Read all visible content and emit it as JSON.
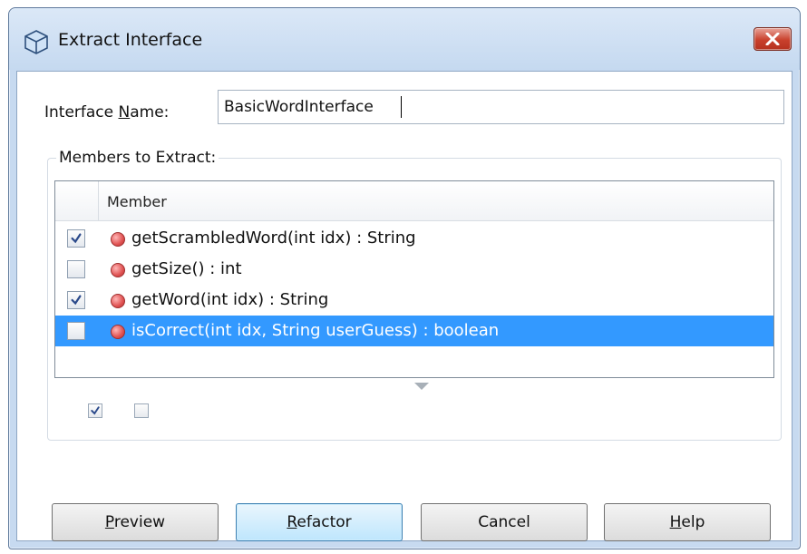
{
  "window": {
    "title": "Extract Interface",
    "close_icon": "close-x-icon",
    "app_icon": "interface-cube-icon"
  },
  "interface_name": {
    "label_before": "Interface ",
    "label_mnemonic": "N",
    "label_after": "ame:",
    "value": "BasicWordInterface"
  },
  "members": {
    "group_label": "Members to Extract:",
    "column_header": "Member",
    "rows": [
      {
        "label": "getScrambledWord(int idx) : String",
        "checked": true,
        "selected": false
      },
      {
        "label": "getSize() : int",
        "checked": false,
        "selected": false
      },
      {
        "label": "getWord(int idx) : String",
        "checked": true,
        "selected": false
      },
      {
        "label": "isCorrect(int idx, String userGuess) : boolean",
        "checked": false,
        "selected": true
      }
    ],
    "select_all_checked": true,
    "select_none_checked": false
  },
  "buttons": {
    "preview": {
      "mnemonic": "P",
      "rest": "review"
    },
    "refactor": {
      "mnemonic": "R",
      "rest": "efactor"
    },
    "cancel": {
      "label": "Cancel"
    },
    "help": {
      "mnemonic": "H",
      "rest": "elp"
    }
  },
  "colors": {
    "selection": "#3399ff",
    "method_dot": "#e05252",
    "close_button": "#c9402c"
  }
}
